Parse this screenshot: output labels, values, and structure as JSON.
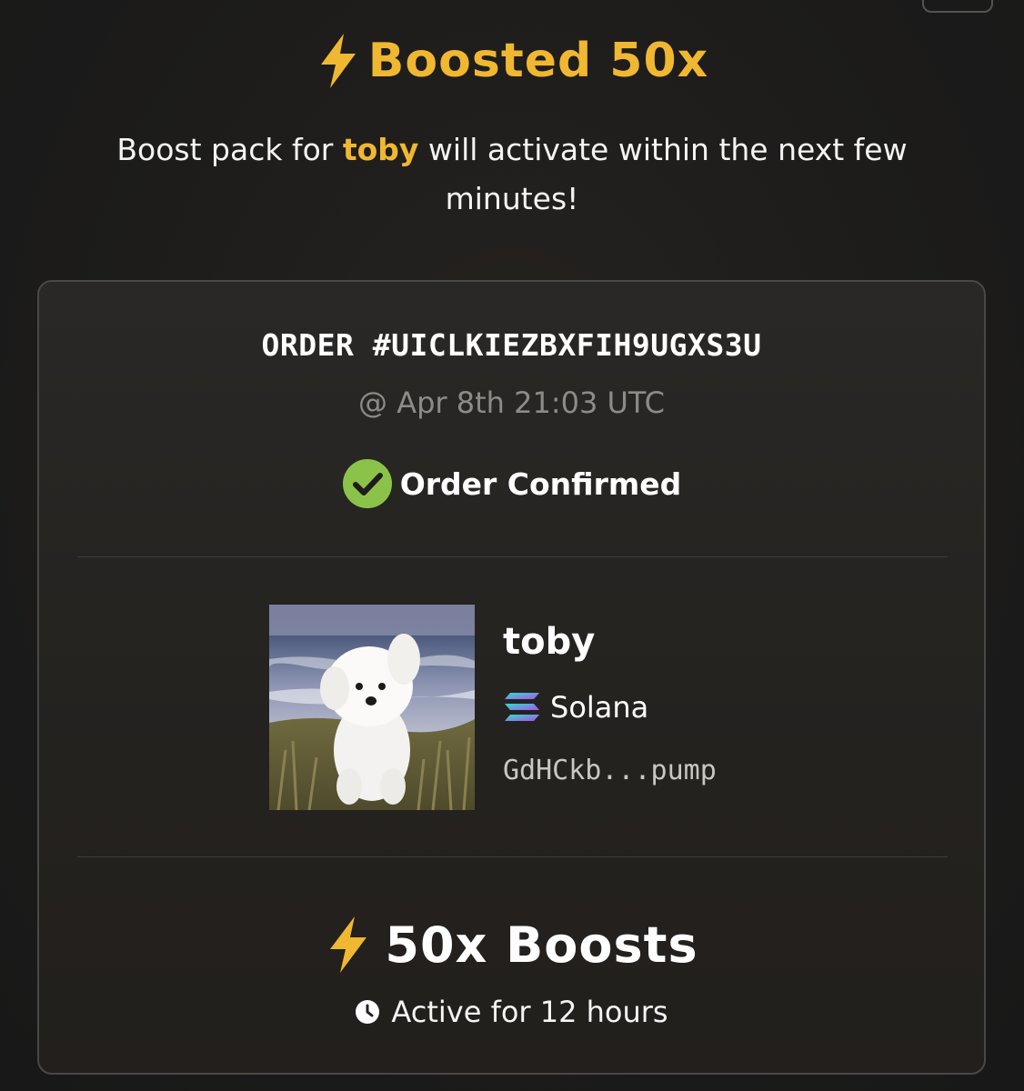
{
  "header": {
    "title": "Boosted 50x",
    "title_icon": "lightning-bolt-icon",
    "message_before": "Boost pack for ",
    "message_token": "toby",
    "message_after": " will activate within the next few",
    "message_line2": "minutes!"
  },
  "order": {
    "id": "ORDER #UICLKIEZBXFIH9UGXS3U",
    "timestamp": "@ Apr 8th 21:03 UTC",
    "status": "Order Confirmed",
    "status_icon": "check-circle-icon",
    "status_color": "#8bc34a"
  },
  "token": {
    "name": "toby",
    "chain": "Solana",
    "chain_icon": "solana-icon",
    "address": "GdHCkb...pump"
  },
  "boost": {
    "label": "50x Boosts",
    "icon": "lightning-bolt-icon",
    "duration": "Active for 12 hours",
    "duration_icon": "clock-icon"
  },
  "colors": {
    "accent": "#f0b731",
    "background": "#1d1c1b",
    "card_border": "#4a4845",
    "muted_text": "#8d8b88"
  }
}
